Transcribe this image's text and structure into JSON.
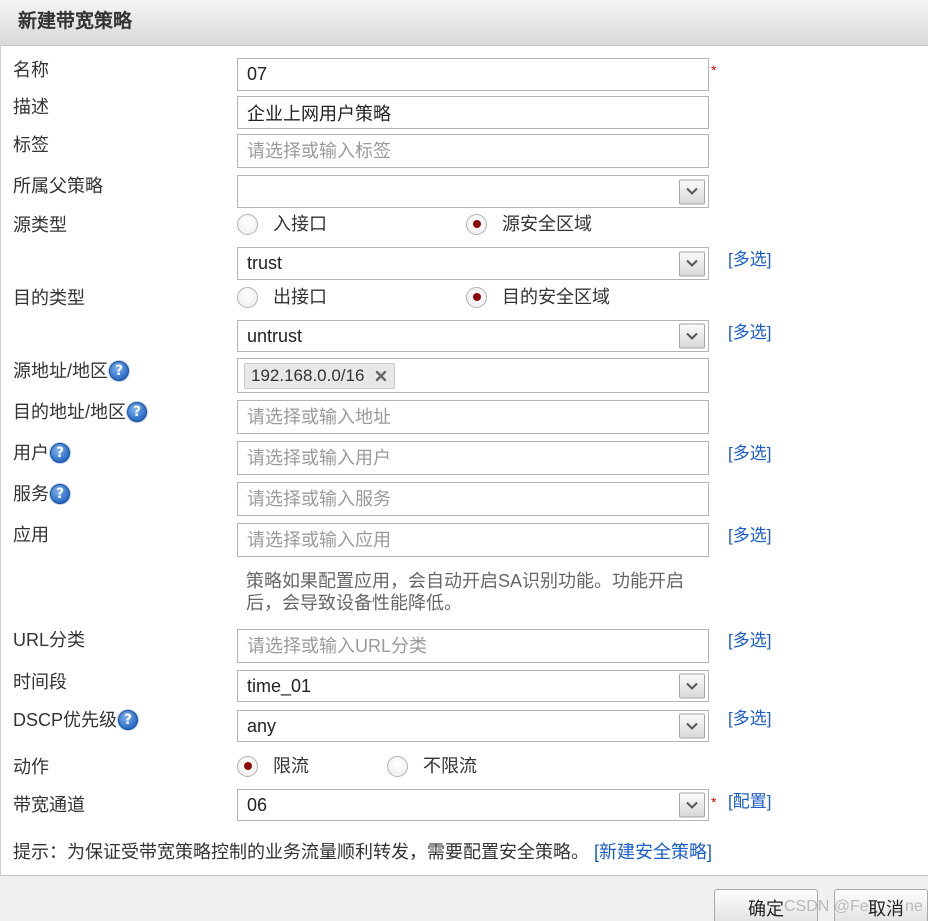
{
  "dialog": {
    "title": "新建带宽策略",
    "required_mark": "*"
  },
  "fields": {
    "name": {
      "label": "名称",
      "value": "07"
    },
    "description": {
      "label": "描述",
      "value": "企业上网用户策略"
    },
    "tags": {
      "label": "标签",
      "placeholder": "请选择或输入标签"
    },
    "parent_policy": {
      "label": "所属父策略"
    },
    "source_type": {
      "label": "源类型",
      "options": [
        {
          "label": "入接口",
          "checked": false
        },
        {
          "label": "源安全区域",
          "checked": true
        }
      ]
    },
    "source_zone": {
      "value": "trust",
      "multi_select": "[多选]"
    },
    "dest_type": {
      "label": "目的类型",
      "options": [
        {
          "label": "出接口",
          "checked": false
        },
        {
          "label": "目的安全区域",
          "checked": true
        }
      ]
    },
    "dest_zone": {
      "value": "untrust",
      "multi_select": "[多选]"
    },
    "source_address": {
      "label": "源地址/地区",
      "tags": [
        "192.168.0.0/16"
      ]
    },
    "dest_address": {
      "label": "目的地址/地区",
      "placeholder": "请选择或输入地址"
    },
    "user": {
      "label": "用户",
      "placeholder": "请选择或输入用户",
      "multi_select": "[多选]"
    },
    "service": {
      "label": "服务",
      "placeholder": "请选择或输入服务"
    },
    "application": {
      "label": "应用",
      "placeholder": "请选择或输入应用",
      "multi_select": "[多选]",
      "hint": "策略如果配置应用，会自动开启SA识别功能。功能开启后，会导致设备性能降低。"
    },
    "url_category": {
      "label": "URL分类",
      "placeholder": "请选择或输入URL分类",
      "multi_select": "[多选]"
    },
    "schedule": {
      "label": "时间段",
      "value": "time_01"
    },
    "dscp": {
      "label": "DSCP优先级",
      "value": "any",
      "multi_select": "[多选]"
    },
    "action": {
      "label": "动作",
      "options": [
        {
          "label": "限流",
          "checked": true
        },
        {
          "label": "不限流",
          "checked": false
        }
      ]
    },
    "bandwidth_channel": {
      "label": "带宽通道",
      "value": "06",
      "config_link": "[配置]"
    }
  },
  "notice": {
    "text": "提示：为保证受带宽策略控制的业务流量顺利转发，需要配置安全策略。",
    "link": "[新建安全策略]"
  },
  "footer": {
    "ok_label": "确定",
    "cancel_label": "取消"
  },
  "watermark": {
    "part1": "CSDN @Fe",
    "part2": "ne"
  },
  "colors": {
    "link": "#1a5cc8",
    "required": "#e00000",
    "radio_checked": "#8b0a0a",
    "help_icon": "#2b6cc4"
  }
}
